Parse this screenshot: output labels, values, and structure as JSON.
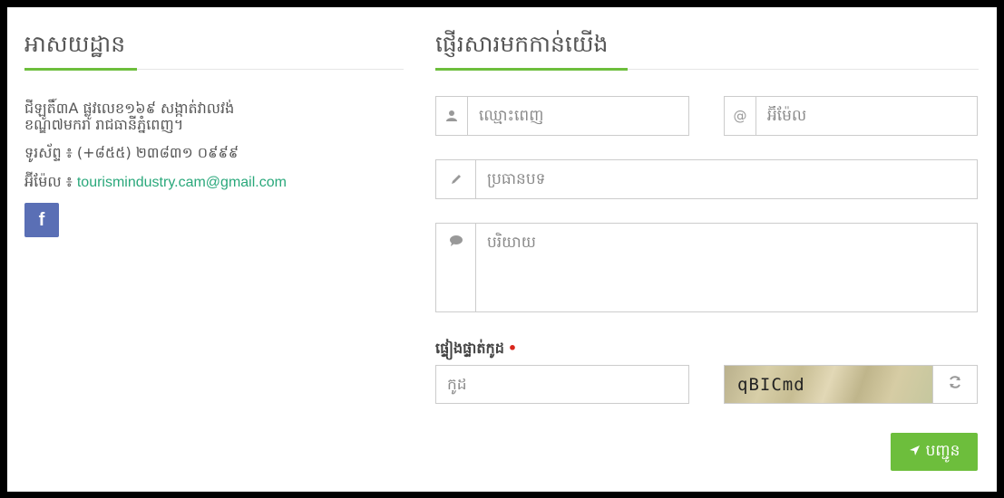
{
  "address_section": {
    "title": "អាសយដ្ឋាន",
    "address_line1": "ជីឡូតិ៍៣A ផ្លូវលេខ១៦៩ សង្កាត់វាលវង់",
    "address_line2": "ខណ្ឌ៧មករា រាជធានីភ្នំពេញ។",
    "phone_label": "ទូរស័ព្ទ ៖",
    "phone_value": "(+៨៥៥) ២៣៨៣១ ០៩៩៩",
    "email_label": "អ៊ីម៉ែល ៖",
    "email_value": "tourismindustry.cam@gmail.com",
    "facebook_icon": "facebook-icon",
    "facebook_glyph": "f"
  },
  "contact_section": {
    "title": "ផ្ញើរសារមកកាន់យើង",
    "name_placeholder": "ឈ្មោះពេញ",
    "name_icon": "user-icon",
    "email_placeholder": "អ៊ីម៉ែល",
    "email_icon": "at-icon",
    "subject_placeholder": "ប្រធានបទ",
    "subject_icon": "pencil-icon",
    "message_placeholder": "បរិយាយ",
    "message_icon": "comment-icon",
    "captcha_label": "ផ្ទៀងផ្ទាត់កូដ",
    "captcha_required": "•",
    "captcha_placeholder": "កូដ",
    "captcha_text": "qBICmd",
    "refresh_icon": "refresh-icon",
    "submit_label": "បញ្ជូន",
    "submit_icon": "send-icon"
  },
  "colors": {
    "accent": "#6dbe3c",
    "link": "#2aa87b",
    "facebook": "#5a6fb5",
    "required": "#d9261c"
  }
}
